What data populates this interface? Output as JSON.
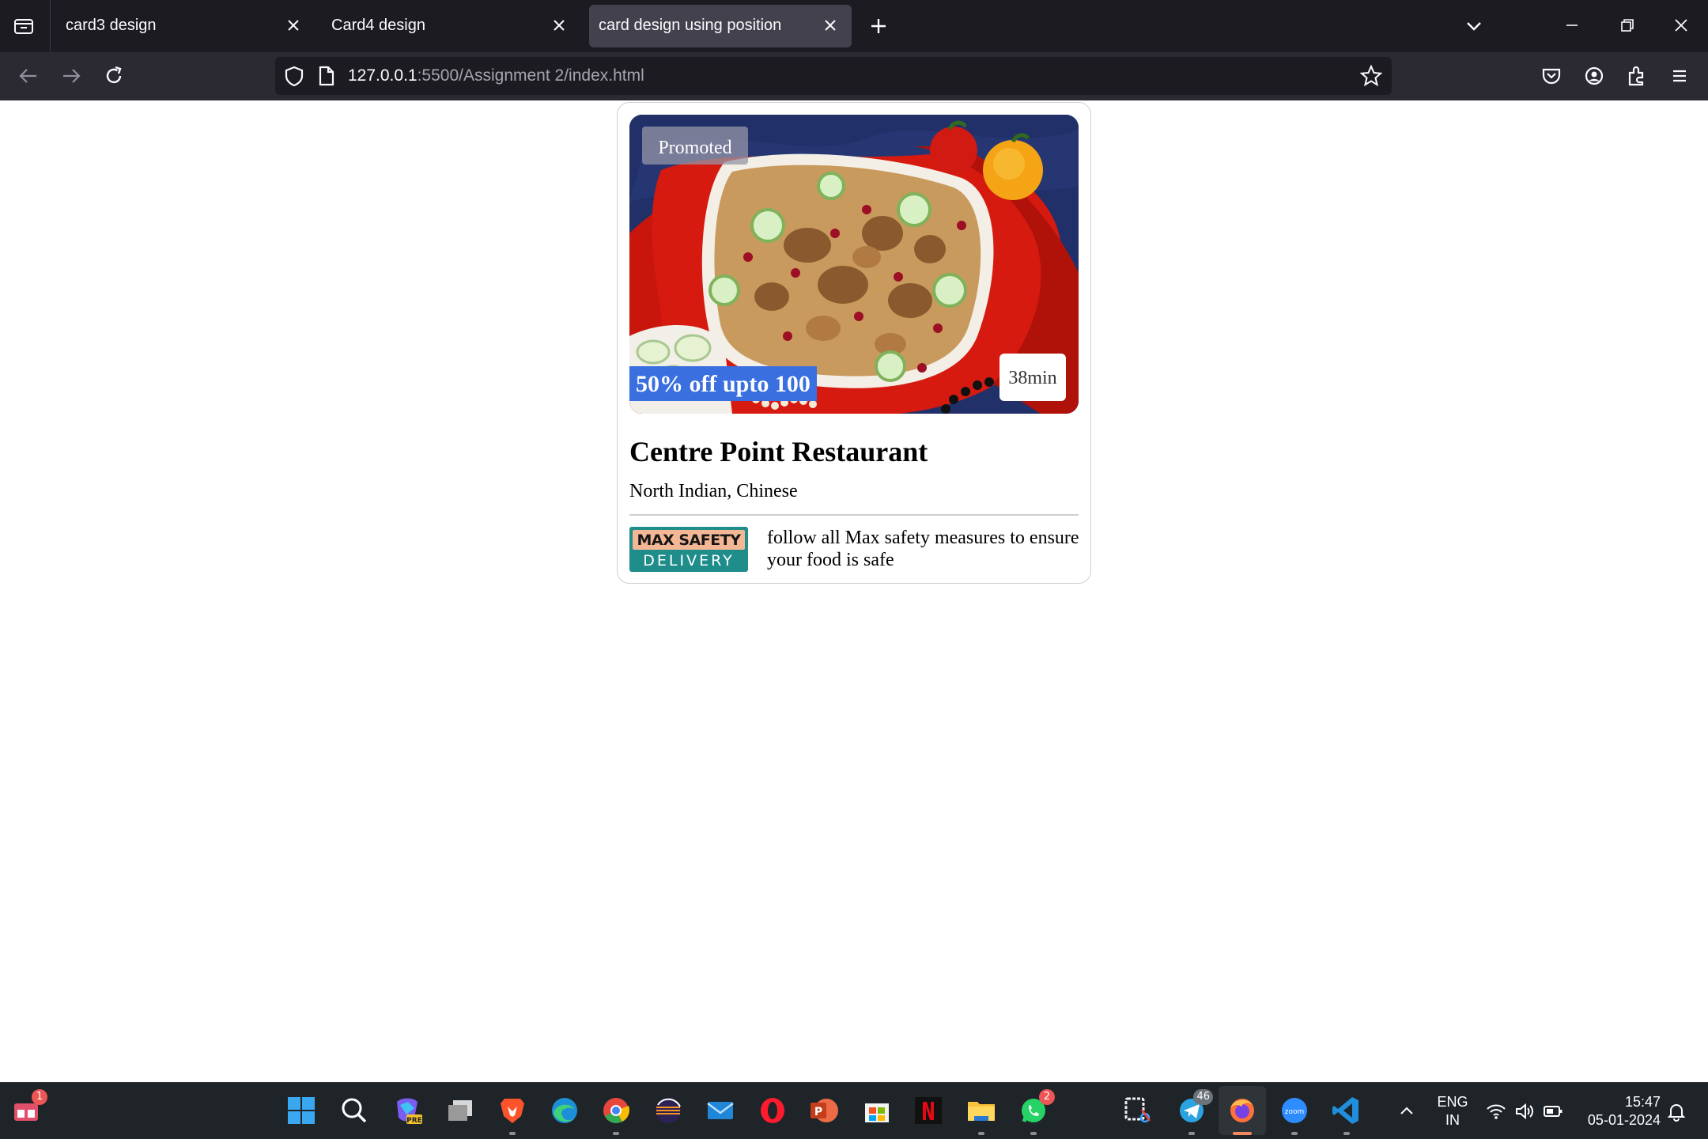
{
  "browser": {
    "tabs": [
      {
        "title": "card3 design",
        "active": false
      },
      {
        "title": "Card4 design",
        "active": false
      },
      {
        "title": "card design using position",
        "active": true
      }
    ],
    "url": {
      "host": "127.0.0.1",
      "path": ":5500/Assignment 2/index.html"
    }
  },
  "card": {
    "promoted_label": "Promoted",
    "offer_label": "50% off upto 100",
    "delivery_time": "38min",
    "restaurant_name": "Centre Point Restaurant",
    "cuisine": "North Indian, Chinese",
    "safety_logo_top": "MAX SAFETY",
    "safety_logo_bottom": "DELIVERY",
    "safety_text": "follow all Max safety measures to ensure your food is safe",
    "colors": {
      "offer_badge": "#3a6fe0",
      "safety_logo_bg": "#1f8d8a",
      "safety_logo_top": "#f4b795"
    }
  },
  "taskbar": {
    "widgets_badge": "1",
    "whatsapp_badge": "2",
    "telegram_badge": "46",
    "language_line1": "ENG",
    "language_line2": "IN",
    "time": "15:47",
    "date": "05-01-2024",
    "apps": [
      "start-icon",
      "search-icon",
      "copilot-icon",
      "task-view-icon",
      "brave-icon",
      "edge-icon",
      "chrome-icon",
      "eclipse-icon",
      "mail-icon",
      "opera-icon",
      "powerpoint-icon",
      "store-icon",
      "netflix-icon",
      "file-explorer-icon",
      "whatsapp-icon",
      "snipping-tool-icon",
      "telegram-icon",
      "firefox-icon",
      "zoom-icon",
      "vscode-icon"
    ]
  }
}
